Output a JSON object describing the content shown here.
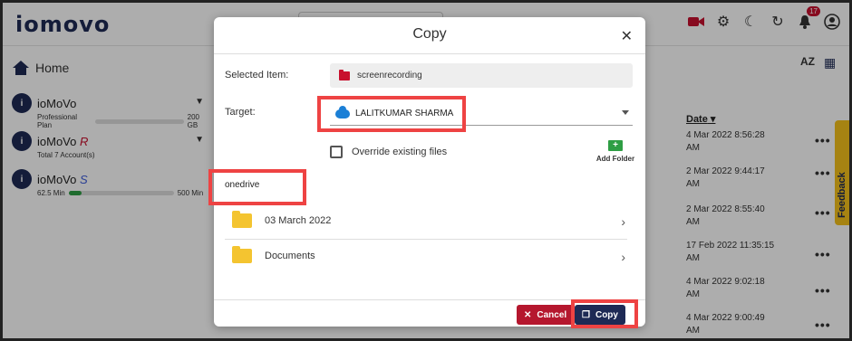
{
  "app": {
    "logo_text": "iomovo",
    "feedback_label": "Feedback"
  },
  "sidebar": {
    "home_label": "Home",
    "accounts": [
      {
        "name": "ioMoVo",
        "suffix": "",
        "plan": "Professional Plan",
        "quota": "200 GB",
        "usage": 0
      },
      {
        "name": "ioMoVo",
        "suffix": "R",
        "plan": "Total 7 Account(s)",
        "quota": "",
        "usage": null
      },
      {
        "name": "ioMoVo",
        "suffix": "S",
        "plan": "62.5 Min",
        "quota": "500 Min",
        "usage": 0.12
      }
    ]
  },
  "list": {
    "date_header": "Date",
    "rows": [
      {
        "date": "4 Mar 2022 8:56:28 AM"
      },
      {
        "date": "2 Mar 2022 9:44:17 AM"
      },
      {
        "date": "2 Mar 2022 8:55:40 AM"
      },
      {
        "date": "17 Feb 2022 11:35:15 AM"
      },
      {
        "date": "4 Mar 2022 9:02:18 AM"
      },
      {
        "date": "4 Mar 2022 9:00:49 AM"
      }
    ],
    "sort_icon_text": "AZ"
  },
  "dialog": {
    "title": "Copy",
    "selected_item_label": "Selected Item:",
    "selected_item_value": "screenrecording",
    "target_label": "Target:",
    "target_value": "LALITKUMAR SHARMA",
    "override_label": "Override existing files",
    "add_folder_label": "Add Folder",
    "path_label": "onedrive",
    "folders": [
      {
        "name": "03 March 2022"
      },
      {
        "name": "Documents"
      }
    ],
    "cancel_label": "Cancel",
    "copy_label": "Copy"
  },
  "colors": {
    "brand_navy": "#1e2a55",
    "brand_red": "#c8102e",
    "highlight": "#ee4343",
    "feedback": "#f5c21b"
  }
}
